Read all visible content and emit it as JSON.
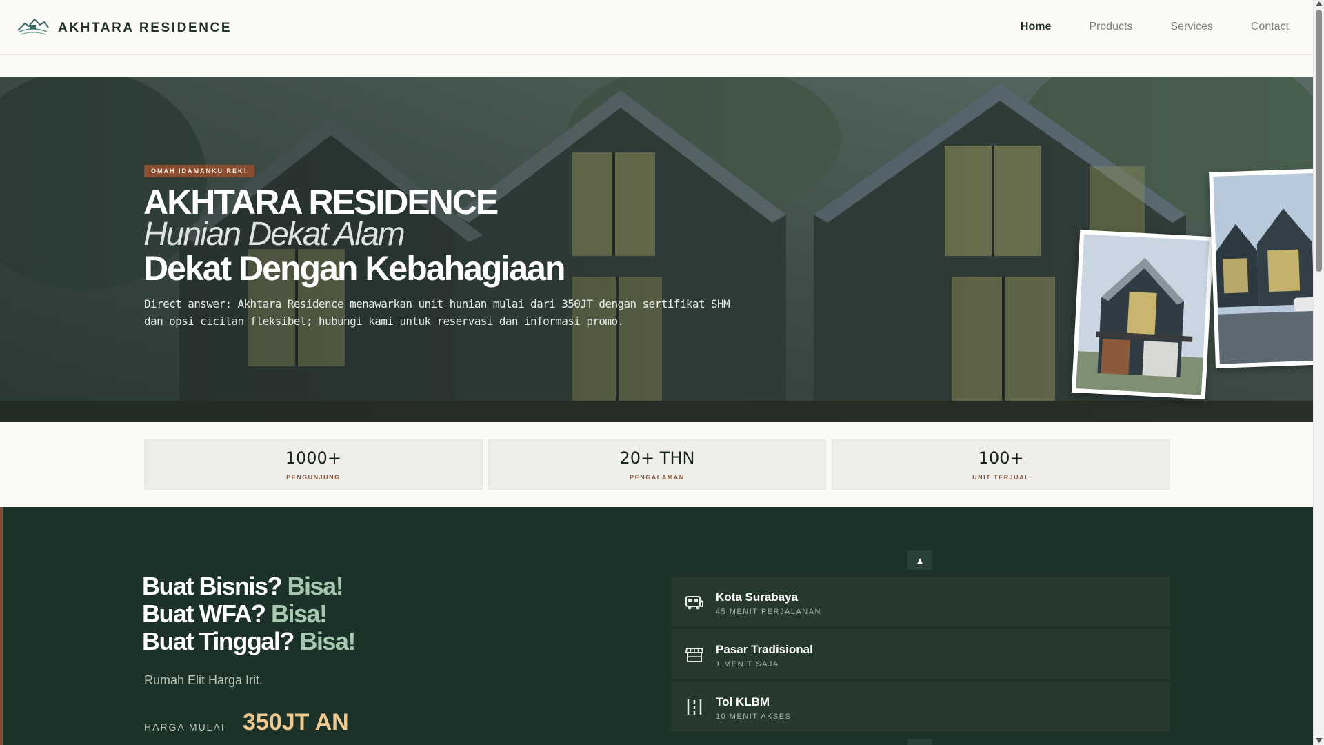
{
  "header": {
    "brand": "AKHTARA RESIDENCE",
    "nav": [
      {
        "label": "Home",
        "active": true
      },
      {
        "label": "Products",
        "active": false
      },
      {
        "label": "Services",
        "active": false
      },
      {
        "label": "Contact",
        "active": false
      }
    ]
  },
  "hero": {
    "badge": "OMAH IDAMANKU REK!",
    "title": "AKHTARA RESIDENCE",
    "subtitle_italic": "Hunian Dekat Alam",
    "subtitle": "Dekat Dengan Kebahagiaan",
    "description": "Direct answer: Akhtara Residence menawarkan unit hunian mulai dari 350JT dengan sertifikat SHM dan opsi cicilan fleksibel; hubungi kami untuk reservasi dan informasi promo."
  },
  "stats": [
    {
      "value": "1000+",
      "label": "PENGUNJUNG"
    },
    {
      "value": "20+ THN",
      "label": "PENGALAMAN"
    },
    {
      "value": "100+",
      "label": "UNIT TERJUAL"
    }
  ],
  "features": {
    "lines": [
      {
        "text": "Buat Bisnis?",
        "highlight": "Bisa!"
      },
      {
        "text": "Buat WFA?",
        "highlight": "Bisa!"
      },
      {
        "text": "Buat Tinggal?",
        "highlight": "Bisa!"
      }
    ],
    "tagline": "Rumah Elit Harga Irit.",
    "price_label": "HARGA MULAI",
    "price_value": "350JT AN",
    "carousel_up": "▲",
    "locations": [
      {
        "icon": "bus-icon",
        "title": "Kota Surabaya",
        "sub": "45 MENIT PERJALANAN"
      },
      {
        "icon": "store-icon",
        "title": "Pasar Tradisional",
        "sub": "1 MENIT SAJA"
      },
      {
        "icon": "road-icon",
        "title": "Tol KLBM",
        "sub": "10 MENIT AKSES"
      }
    ]
  },
  "colors": {
    "accent": "#8a4d30",
    "dark_green": "#1c3229",
    "highlight_green": "#a6c8b0",
    "price": "#f2c98f"
  }
}
